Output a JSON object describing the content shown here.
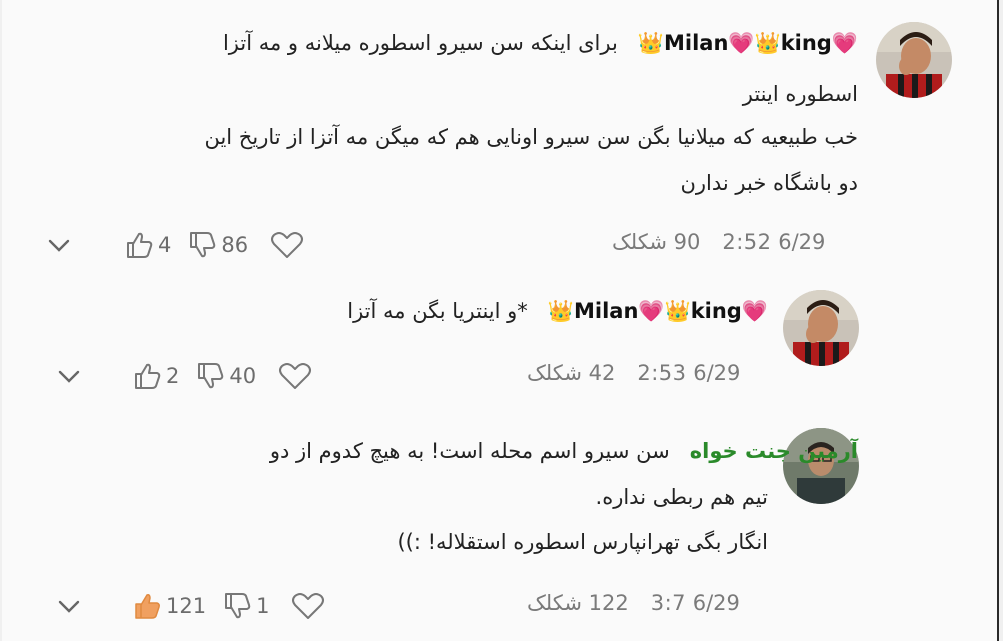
{
  "comments": [
    {
      "author": "💗Milan💗👑king👑",
      "text_line1": "برای اینکه سن سیرو اسطوره میلانه و مه آتزا",
      "text_line2": "اسطوره اینتر",
      "text_line3": "خب طبیعیه که میلانیا بگن سن سیرو اونایی هم که میگن مه آتزا از تاریخ این",
      "text_line4": "دو باشگاه خبر ندارن",
      "date": "6/29",
      "time": "2:52",
      "count_label": "90 شکلک",
      "dislikes": "86",
      "likes": "4"
    },
    {
      "author": "💗Milan💗👑king👑",
      "text_line1": "*و اینتریا بگن مه آتزا",
      "date": "6/29",
      "time": "2:53",
      "count_label": "42 شکلک",
      "dislikes": "40",
      "likes": "2"
    },
    {
      "author": "آرمین جنت خواه",
      "text_line1": "سن سیرو اسم محله است! به هیچ کدوم از دو",
      "text_line2": "تیم هم ربطی نداره.",
      "text_line3": "انگار بگی تهرانپارس اسطوره استقلاله! :))",
      "date": "6/29",
      "time": "3:7",
      "count_label": "122 شکلک",
      "dislikes": "1",
      "likes": "121"
    }
  ],
  "icons": {
    "heart": "heart-outline-icon",
    "dislike": "thumbs-down-outline-icon",
    "like": "thumbs-up-icon",
    "expand": "chevron-down-icon"
  },
  "colors": {
    "accent_green": "#2a8a2a",
    "like_active": "#f0a060",
    "muted": "#7a7a7a"
  }
}
